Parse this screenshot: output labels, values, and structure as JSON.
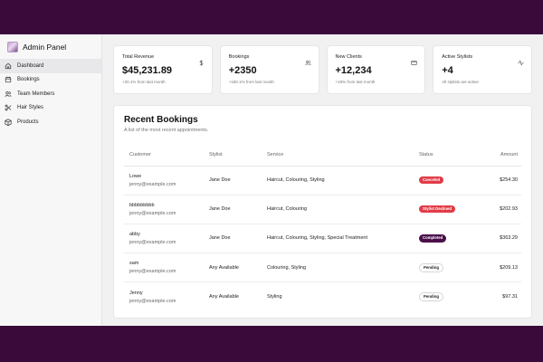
{
  "app": {
    "title": "Admin Panel"
  },
  "sidebar": {
    "items": [
      {
        "label": "Dashboard",
        "icon": "house-icon",
        "active": true
      },
      {
        "label": "Bookings",
        "icon": "calendar-icon",
        "active": false
      },
      {
        "label": "Team Members",
        "icon": "users-icon",
        "active": false
      },
      {
        "label": "Hair Styles",
        "icon": "scissors-icon",
        "active": false
      },
      {
        "label": "Products",
        "icon": "package-icon",
        "active": false
      }
    ]
  },
  "stats": [
    {
      "label": "Total Revenue",
      "value": "$45,231.89",
      "sub": "+20.1% from last month",
      "icon": "dollar-icon"
    },
    {
      "label": "Bookings",
      "value": "+2350",
      "sub": "+180.1% from last month",
      "icon": "users-icon"
    },
    {
      "label": "New Clients",
      "value": "+12,234",
      "sub": "+19% from last month",
      "icon": "credit-card-icon"
    },
    {
      "label": "Active Stylists",
      "value": "+4",
      "sub": "All stylists are active",
      "icon": "activity-icon"
    }
  ],
  "recent": {
    "title": "Recent Bookings",
    "description": "A list of the most recent appointments.",
    "columns": {
      "customer": "Customer",
      "stylist": "Stylist",
      "service": "Service",
      "status": "Status",
      "amount": "Amount"
    },
    "rows": [
      {
        "name": "Lowe",
        "email": "jenny@example.com",
        "stylist": "Jane Doe",
        "service": "Haircut, Colouring, Styling",
        "status": "Canceled",
        "status_style": "red",
        "amount": "$254.30"
      },
      {
        "name": "bbbbbbbbb",
        "email": "jenny@example.com",
        "stylist": "Jane Doe",
        "service": "Haircut, Colouring",
        "status": "Stylist Declined",
        "status_style": "red",
        "amount": "$202.93"
      },
      {
        "name": "abby",
        "email": "jenny@example.com",
        "stylist": "Jane Doe",
        "service": "Haircut, Colouring, Styling, Special Treatment",
        "status": "Completed",
        "status_style": "dark",
        "amount": "$363.29"
      },
      {
        "name": "sam",
        "email": "jenny@example.com",
        "stylist": "Any Available",
        "service": "Colouring, Styling",
        "status": "Pending",
        "status_style": "outline",
        "amount": "$209.13"
      },
      {
        "name": "Jenny",
        "email": "jenny@example.com",
        "stylist": "Any Available",
        "service": "Styling",
        "status": "Pending",
        "status_style": "outline",
        "amount": "$97.31"
      }
    ]
  },
  "colors": {
    "frame": "#3a0a3a",
    "danger": "#e23b47",
    "primary": "#4a0f4a",
    "background": "#f1f1f2"
  }
}
